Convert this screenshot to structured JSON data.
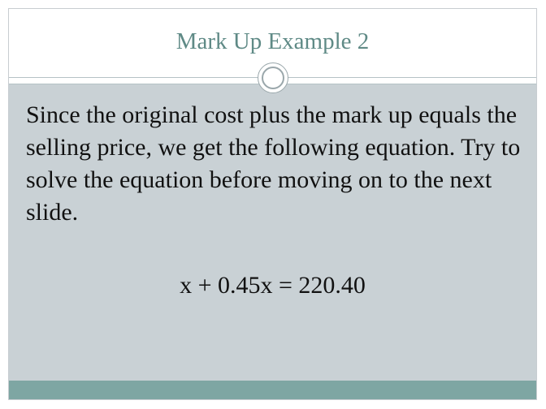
{
  "slide": {
    "title": "Mark Up Example 2",
    "body_text": "Since the original cost plus the mark up equals the selling price, we get the following equation.  Try to solve the equation before moving on to the next slide.",
    "equation": "x + 0.45x = 220.40"
  },
  "colors": {
    "title_text": "#5f8a86",
    "content_background": "#c9d1d5",
    "footer_bar": "#7ea6a3",
    "body_text": "#111111"
  }
}
